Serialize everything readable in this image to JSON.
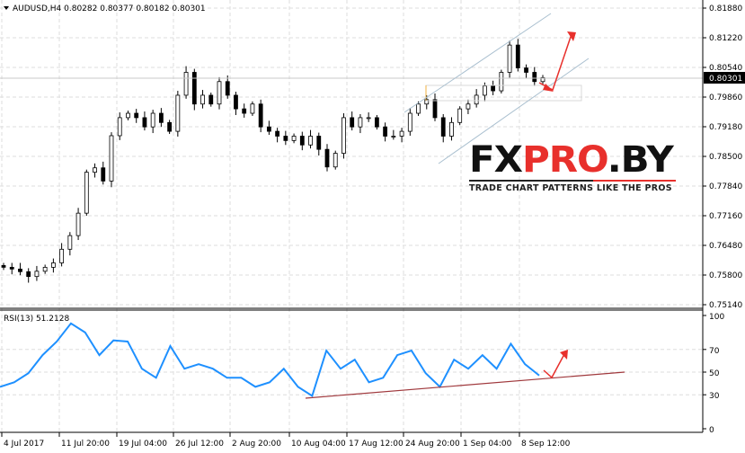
{
  "header": {
    "symbol": "AUDUSD,H4",
    "open": "0.80282",
    "high": "0.80377",
    "low": "0.80182",
    "close": "0.80301"
  },
  "price_axis": {
    "ticks": [
      "0.81880",
      "0.81220",
      "0.80540",
      "0.79860",
      "0.79180",
      "0.78500",
      "0.77840",
      "0.77160",
      "0.76480",
      "0.75800",
      "0.75140"
    ],
    "current": "0.80301"
  },
  "rsi": {
    "label": "RSI(13) 51.2128",
    "ticks": [
      "100",
      "70",
      "50",
      "30",
      "0"
    ]
  },
  "time_axis": [
    "4 Jul 2017",
    "11 Jul 20:00",
    "19 Jul 04:00",
    "26 Jul 12:00",
    "2 Aug 20:00",
    "10 Aug 04:00",
    "17 Aug 12:00",
    "24 Aug 20:00",
    "1 Sep 04:00",
    "8 Sep 12:00"
  ],
  "logo": {
    "text_black": "FX",
    "text_red": "PRO",
    "text_black2": ".BY",
    "tagline": "TRADE CHART PATTERNS LIKE THE PROS"
  },
  "colors": {
    "rsi_line": "#1e90ff",
    "arrow": "#e8302c",
    "trendline": "#a0393d",
    "channel": "#a9bfcf"
  },
  "chart_data": {
    "type": "candlestick",
    "ylim": [
      0.7514,
      0.8188
    ],
    "closes": [
      0.7599,
      0.7595,
      0.7589,
      0.7578,
      0.759,
      0.7599,
      0.7609,
      0.764,
      0.7671,
      0.7722,
      0.7815,
      0.7825,
      0.7795,
      0.7898,
      0.7939,
      0.7949,
      0.7939,
      0.7918,
      0.7949,
      0.7928,
      0.7908,
      0.799,
      0.8042,
      0.797,
      0.799,
      0.797,
      0.8021,
      0.799,
      0.7959,
      0.7949,
      0.797,
      0.7918,
      0.7908,
      0.7897,
      0.7887,
      0.7897,
      0.7877,
      0.7897,
      0.7867,
      0.7827,
      0.7858,
      0.7939,
      0.7918,
      0.7939,
      0.7939,
      0.7918,
      0.7897,
      0.7897,
      0.7908,
      0.7949,
      0.797,
      0.798,
      0.7939,
      0.7897,
      0.7928,
      0.7959,
      0.797,
      0.799,
      0.8011,
      0.8,
      0.8042,
      0.8104,
      0.8052,
      0.8042,
      0.8021,
      0.803
    ],
    "rsi_values": [
      37,
      41,
      49,
      65,
      77,
      93,
      85,
      65,
      78,
      77,
      53,
      45,
      73,
      53,
      57,
      53,
      45,
      45,
      37,
      41,
      53,
      37,
      29,
      69,
      53,
      61,
      41,
      45,
      65,
      69,
      49,
      37,
      61,
      53,
      65,
      53,
      75,
      57,
      47
    ],
    "rsi_ylim": [
      0,
      100
    ]
  }
}
